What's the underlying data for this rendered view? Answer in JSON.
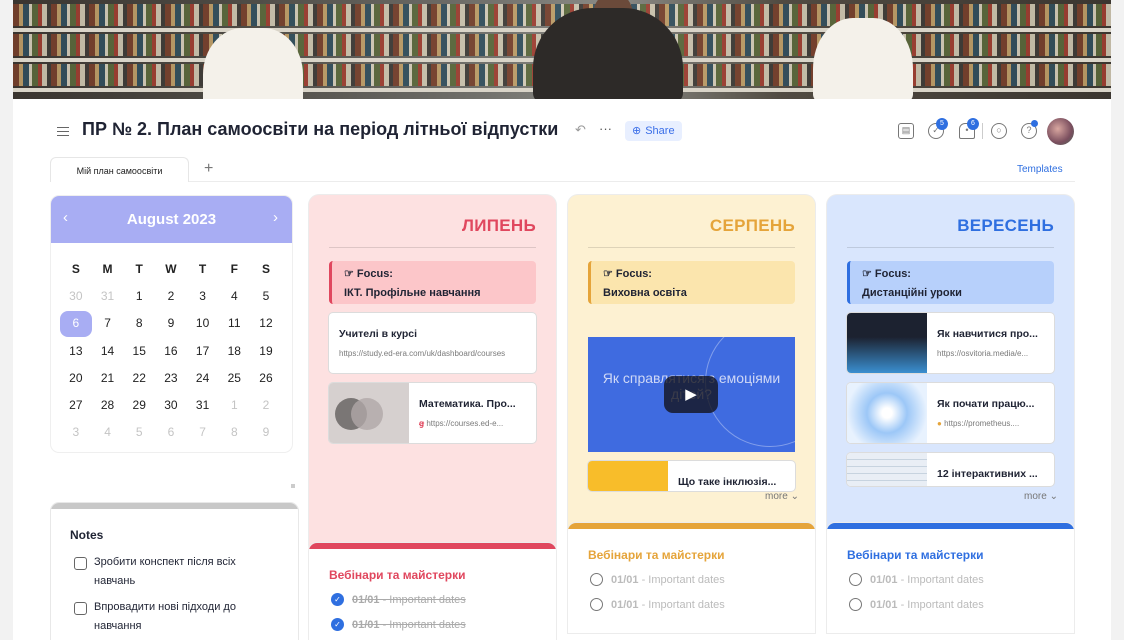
{
  "header": {
    "title": "ПР № 2. План самоосвіти на період літньої відпустки",
    "share_label": "Share",
    "tasks_badge": "5",
    "notifications_badge": "6"
  },
  "tabs": {
    "active": "Мій план самоосвіти",
    "add": "+",
    "templates": "Templates"
  },
  "calendar": {
    "title": "August 2023",
    "weekdays": [
      "S",
      "M",
      "T",
      "W",
      "T",
      "F",
      "S"
    ],
    "days": [
      [
        "30",
        "31",
        "1",
        "2",
        "3",
        "4",
        "5"
      ],
      [
        "6",
        "7",
        "8",
        "9",
        "10",
        "11",
        "12"
      ],
      [
        "13",
        "14",
        "15",
        "16",
        "17",
        "18",
        "19"
      ],
      [
        "20",
        "21",
        "22",
        "23",
        "24",
        "25",
        "26"
      ],
      [
        "27",
        "28",
        "29",
        "30",
        "31",
        "1",
        "2"
      ],
      [
        "3",
        "4",
        "5",
        "6",
        "7",
        "8",
        "9"
      ]
    ],
    "today": "6"
  },
  "notes": {
    "title": "Notes",
    "items": [
      "Зробити конспект після всіх навчань",
      "Впровадити нові підходи до навчання"
    ]
  },
  "columns": [
    {
      "title": "ЛИПЕНЬ",
      "focus_label": "☞ Focus:",
      "focus_text": "ІКТ. Профільне навчання",
      "cards": [
        {
          "title": "Учителі в курсі",
          "url": "https://study.ed-era.com/uk/dashboard/courses"
        },
        {
          "title": "Математика. Про...",
          "url": "https://courses.ed-e..."
        }
      ],
      "section_title": "Вебінари та майстерки",
      "todos": [
        {
          "date": "01/01",
          "text": " - Important dates"
        },
        {
          "date": "01/01",
          "text": " - Important dates"
        }
      ]
    },
    {
      "title": "СЕРПЕНЬ",
      "focus_label": "☞ Focus:",
      "focus_text": "Виховна освіта",
      "video_caption": "Як справлятися з емоціями дітей?",
      "cards": [
        {
          "title": "Що таке інклюзія..."
        }
      ],
      "more": "more",
      "section_title": "Вебінари та майстерки",
      "todos": [
        {
          "date": "01/01",
          "text": " - Important dates"
        },
        {
          "date": "01/01",
          "text": " - Important dates"
        }
      ]
    },
    {
      "title": "ВЕРЕСЕНЬ",
      "focus_label": "☞ Focus:",
      "focus_text": "Дистанційні уроки",
      "cards": [
        {
          "title": "Як навчитися про...",
          "url": "https://osvitoria.media/e..."
        },
        {
          "title": "Як почати працю...",
          "url": "https://prometheus...."
        },
        {
          "title": "12 інтерактивних ..."
        }
      ],
      "more": "more",
      "section_title": "Вебінари та майстерки",
      "todos": [
        {
          "date": "01/01",
          "text": " - Important dates"
        },
        {
          "date": "01/01",
          "text": " - Important dates"
        }
      ]
    }
  ],
  "colors": {
    "accent": "#2f6fe0",
    "july": "#e0475e",
    "august": "#e5a43a",
    "september": "#2f6fe0",
    "calendar": "#a8adf3"
  }
}
